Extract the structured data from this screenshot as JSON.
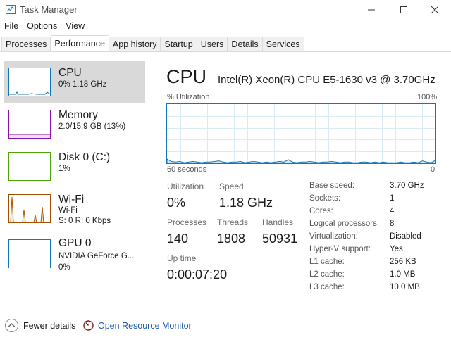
{
  "window": {
    "title": "Task Manager"
  },
  "menu": [
    "File",
    "Options",
    "View"
  ],
  "tabs": [
    "Processes",
    "Performance",
    "App history",
    "Startup",
    "Users",
    "Details",
    "Services"
  ],
  "active_tab": "Performance",
  "sidebar": {
    "items": [
      {
        "name": "CPU",
        "sub1": "0% 1.18 GHz",
        "sub2": "",
        "color": "#1177bb"
      },
      {
        "name": "Memory",
        "sub1": "2.0/15.9 GB (13%)",
        "sub2": "",
        "color": "#8b12ae"
      },
      {
        "name": "Disk 0 (C:)",
        "sub1": "1%",
        "sub2": "",
        "color": "#4da60c"
      },
      {
        "name": "Wi-Fi",
        "sub1": "Wi-Fi",
        "sub2": "S: 0 R: 0 Kbps",
        "color": "#a74f01"
      },
      {
        "name": "GPU 0",
        "sub1": "NVIDIA GeForce G...",
        "sub2": "0%",
        "color": "#1177bb"
      }
    ]
  },
  "main": {
    "title": "CPU",
    "model": "Intel(R) Xeon(R) CPU E5-1630 v3 @ 3.70GHz",
    "util_label": "% Utilization",
    "util_max": "100%",
    "axis_left": "60 seconds",
    "axis_right": "0",
    "stats": {
      "utilization_label": "Utilization",
      "utilization_value": "0%",
      "speed_label": "Speed",
      "speed_value": "1.18 GHz",
      "processes_label": "Processes",
      "processes_value": "140",
      "threads_label": "Threads",
      "threads_value": "1808",
      "handles_label": "Handles",
      "handles_value": "50931",
      "uptime_label": "Up time",
      "uptime_value": "0:00:07:20"
    },
    "info": [
      {
        "label": "Base speed:",
        "value": "3.70 GHz"
      },
      {
        "label": "Sockets:",
        "value": "1"
      },
      {
        "label": "Cores:",
        "value": "4"
      },
      {
        "label": "Logical processors:",
        "value": "8"
      },
      {
        "label": "Virtualization:",
        "value": "Disabled"
      },
      {
        "label": "Hyper-V support:",
        "value": "Yes"
      },
      {
        "label": "L1 cache:",
        "value": "256 KB"
      },
      {
        "label": "L2 cache:",
        "value": "1.0 MB"
      },
      {
        "label": "L3 cache:",
        "value": "10.0 MB"
      }
    ]
  },
  "footer": {
    "fewer_details": "Fewer details",
    "resource_monitor": "Open Resource Monitor"
  },
  "colors": {
    "cpu": "#1177bb",
    "memory": "#8b12ae",
    "disk": "#4da60c",
    "wifi": "#a74f01",
    "link": "#1e5aa8"
  }
}
